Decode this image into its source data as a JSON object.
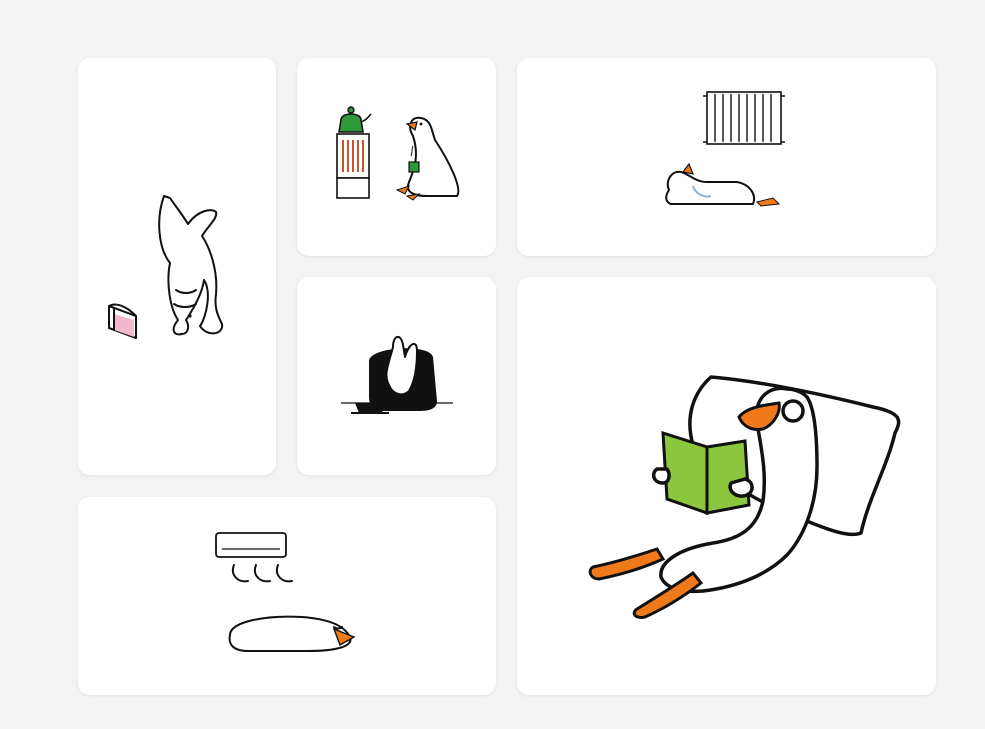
{
  "colors": {
    "page_background": "#f3f3f3",
    "card_background": "#ffffff",
    "ink": "#111111",
    "goose_beak": "#f07a1a",
    "book_green": "#8cc63e",
    "kettle_green": "#2e9a3a",
    "heater_coil": "#c8552a",
    "pink_book": "#f2b8cf"
  },
  "illustrations": [
    {
      "scene": "goose-headstand-with-book",
      "icon": "goose-headstand-icon"
    },
    {
      "scene": "goose-with-heater-and-kettle",
      "icon": "goose-heater-icon"
    },
    {
      "scene": "goose-lying-under-radiator",
      "icon": "goose-radiator-icon"
    },
    {
      "scene": "goose-on-sofa-with-laptop",
      "icon": "goose-sofa-icon"
    },
    {
      "scene": "goose-reading-on-pillow",
      "icon": "goose-reading-icon"
    },
    {
      "scene": "goose-sleeping-under-air-conditioner",
      "icon": "goose-ac-icon"
    }
  ]
}
